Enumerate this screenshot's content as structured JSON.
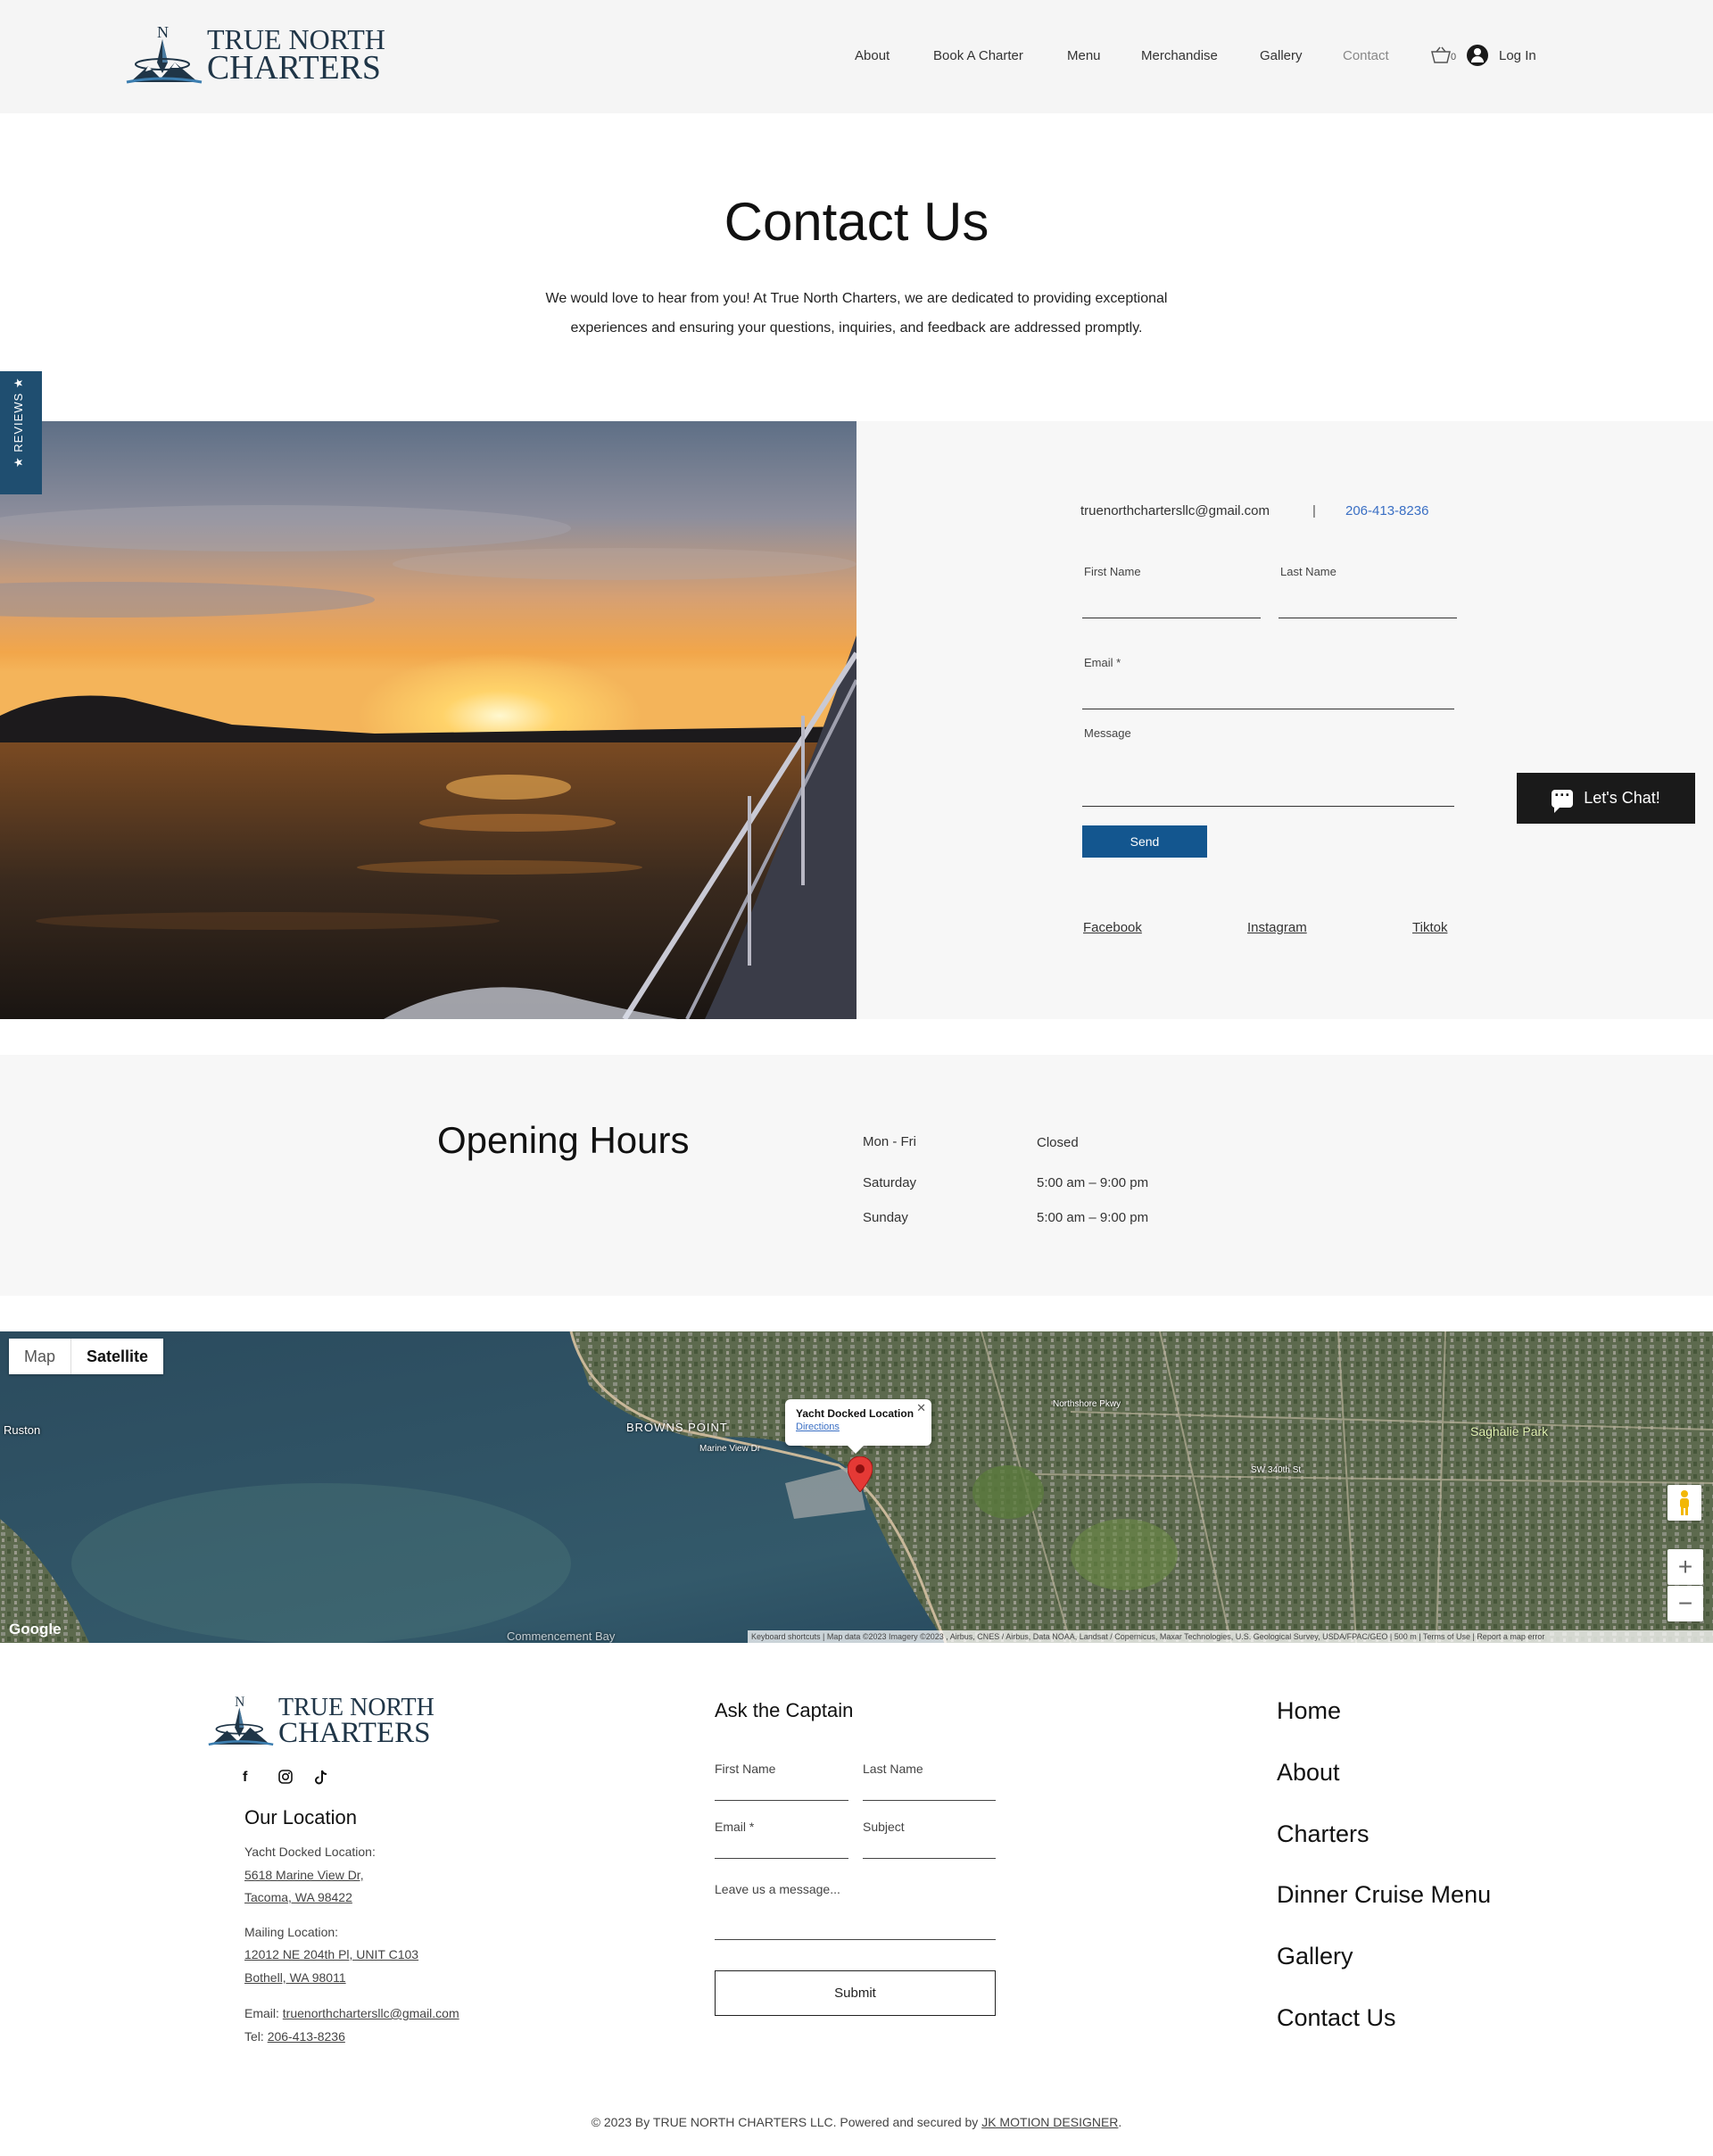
{
  "brand": {
    "line1": "TRUE NORTH",
    "line2": "CHARTERS",
    "mark_letter": "N"
  },
  "nav": {
    "items": [
      "About",
      "Book A Charter",
      "Menu",
      "Merchandise",
      "Gallery",
      "Contact"
    ],
    "active": "Contact",
    "cart_count": "0",
    "login": "Log In"
  },
  "hero": {
    "title": "Contact Us",
    "intro_line1": "We would love to hear from you! At True North Charters, we are dedicated to providing exceptional",
    "intro_line2": "experiences and ensuring your questions, inquiries, and feedback are addressed promptly."
  },
  "reviews_tab": "★ REVIEWS ★",
  "contact": {
    "email": "truenorthchartersllc@gmail.com",
    "separator": "|",
    "phone": "206-413-8236",
    "first_name_label": "First Name",
    "last_name_label": "Last Name",
    "email_label": "Email *",
    "message_label": "Message",
    "send_label": "Send",
    "social": [
      "Facebook",
      "Instagram",
      "Tiktok"
    ]
  },
  "chat": {
    "label": "Let's Chat!"
  },
  "hours": {
    "title": "Opening Hours",
    "rows": [
      {
        "day": "Mon - Fri",
        "time": "Closed"
      },
      {
        "day": "Saturday",
        "time": "5:00 am – 9:00 pm"
      },
      {
        "day": "Sunday",
        "time": "5:00 am – 9:00 pm"
      }
    ]
  },
  "map": {
    "tab_map": "Map",
    "tab_satellite": "Satellite",
    "active_tab": "Satellite",
    "popup_title": "Yacht Docked Location",
    "popup_link": "Directions",
    "labels": [
      "Ruston",
      "BROWNS POINT",
      "Saghalie Park",
      "Commencement Bay",
      "Northshore Pkwy",
      "SW 340th St",
      "Marine View Dr"
    ],
    "logo": "Google",
    "attribution": "Keyboard shortcuts | Map data ©2023 Imagery ©2023 , Airbus, CNES / Airbus, Data NOAA, Landsat / Copernicus, Maxar Technologies, U.S. Geological Survey, USDA/FPAC/GEO | 500 m | Terms of Use | Report a map error",
    "zoom_in": "+",
    "zoom_out": "−"
  },
  "footer": {
    "location_title": "Our Location",
    "yacht_label": "Yacht Docked Location:",
    "yacht_addr1": "5618 Marine View Dr,",
    "yacht_addr2": "Tacoma, WA 98422",
    "mail_label": "Mailing Location:",
    "mail_addr1": "12012 NE 204th Pl, UNIT C103",
    "mail_addr2": "Bothell, WA 98011",
    "email_prefix": "Email: ",
    "email": "truenorthchartersllc@gmail.com",
    "tel_prefix": "Tel: ",
    "tel": "206-413-8236",
    "ask_title": "Ask the Captain",
    "first_name": "First Name",
    "last_name": "Last Name",
    "email_label": "Email *",
    "subject_label": "Subject",
    "message_placeholder": "Leave us a message...",
    "submit": "Submit",
    "nav": [
      "Home",
      "About",
      "Charters",
      "Dinner Cruise Menu",
      "Gallery",
      "Contact Us"
    ],
    "copyright": "© 2023 By TRUE NORTH CHARTERS LLC. Powered and secured by ",
    "designer": "JK MOTION DESIGNER",
    "period": "."
  },
  "colors": {
    "brand_navy": "#1f3547",
    "send_blue": "#13568f",
    "link_blue": "#3a6fc4",
    "reviews_tab": "#1f4e70"
  }
}
